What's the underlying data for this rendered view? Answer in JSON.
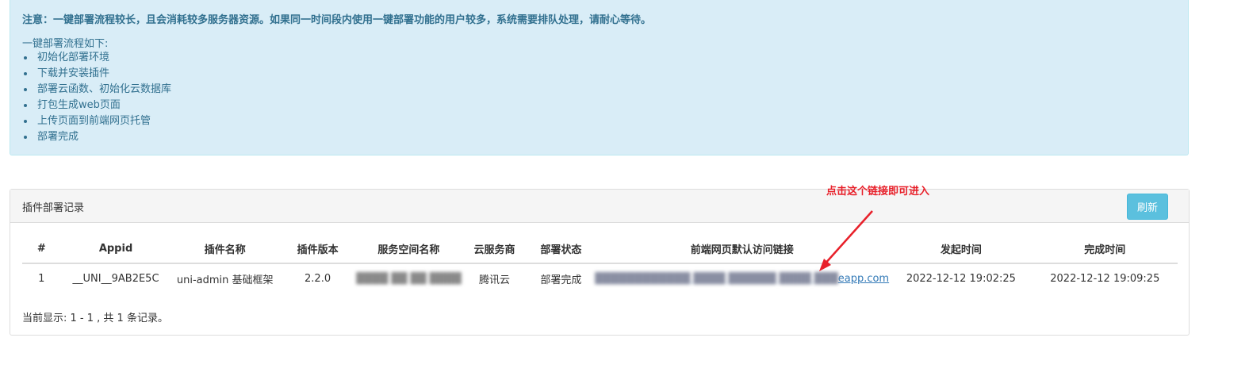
{
  "notice": {
    "title": "注意：一键部署流程较长，且会消耗较多服务器资源。如果同一时间段内使用一键部署功能的用户较多，系统需要排队处理，请耐心等待。",
    "intro": "一键部署流程如下:",
    "steps": [
      "初始化部署环境",
      "下载并安装插件",
      "部署云函数、初始化云数据库",
      "打包生成web页面",
      "上传页面到前端网页托管",
      "部署完成"
    ]
  },
  "panel": {
    "title": "插件部署记录",
    "refresh_label": "刷新"
  },
  "annotation": {
    "text": "点击这个链接即可进入",
    "color": "#e8202a"
  },
  "table": {
    "headers": [
      "#",
      "Appid",
      "插件名称",
      "插件版本",
      "服务空间名称",
      "云服务商",
      "部署状态",
      "前端网页默认访问链接",
      "发起时间",
      "完成时间"
    ],
    "rows": [
      {
        "index": "1",
        "appid": "__UNI__9AB2E5C",
        "plugin_name": "uni-admin 基础框架",
        "plugin_version": "2.2.0",
        "space_name": "████ ██ ██ ████",
        "provider": "腾讯云",
        "status": "部署完成",
        "link_blurred": "████████████ ████ ██████ ████ ███",
        "link_visible": "eapp.com",
        "started_at": "2022-12-12 19:02:25",
        "finished_at": "2022-12-12 19:09:25"
      }
    ]
  },
  "footer": "当前显示: 1 - 1 , 共 1 条记录。",
  "colors": {
    "notice_bg": "#d9edf7",
    "notice_text": "#31708f",
    "button": "#5bc0de",
    "link": "#337ab7"
  }
}
